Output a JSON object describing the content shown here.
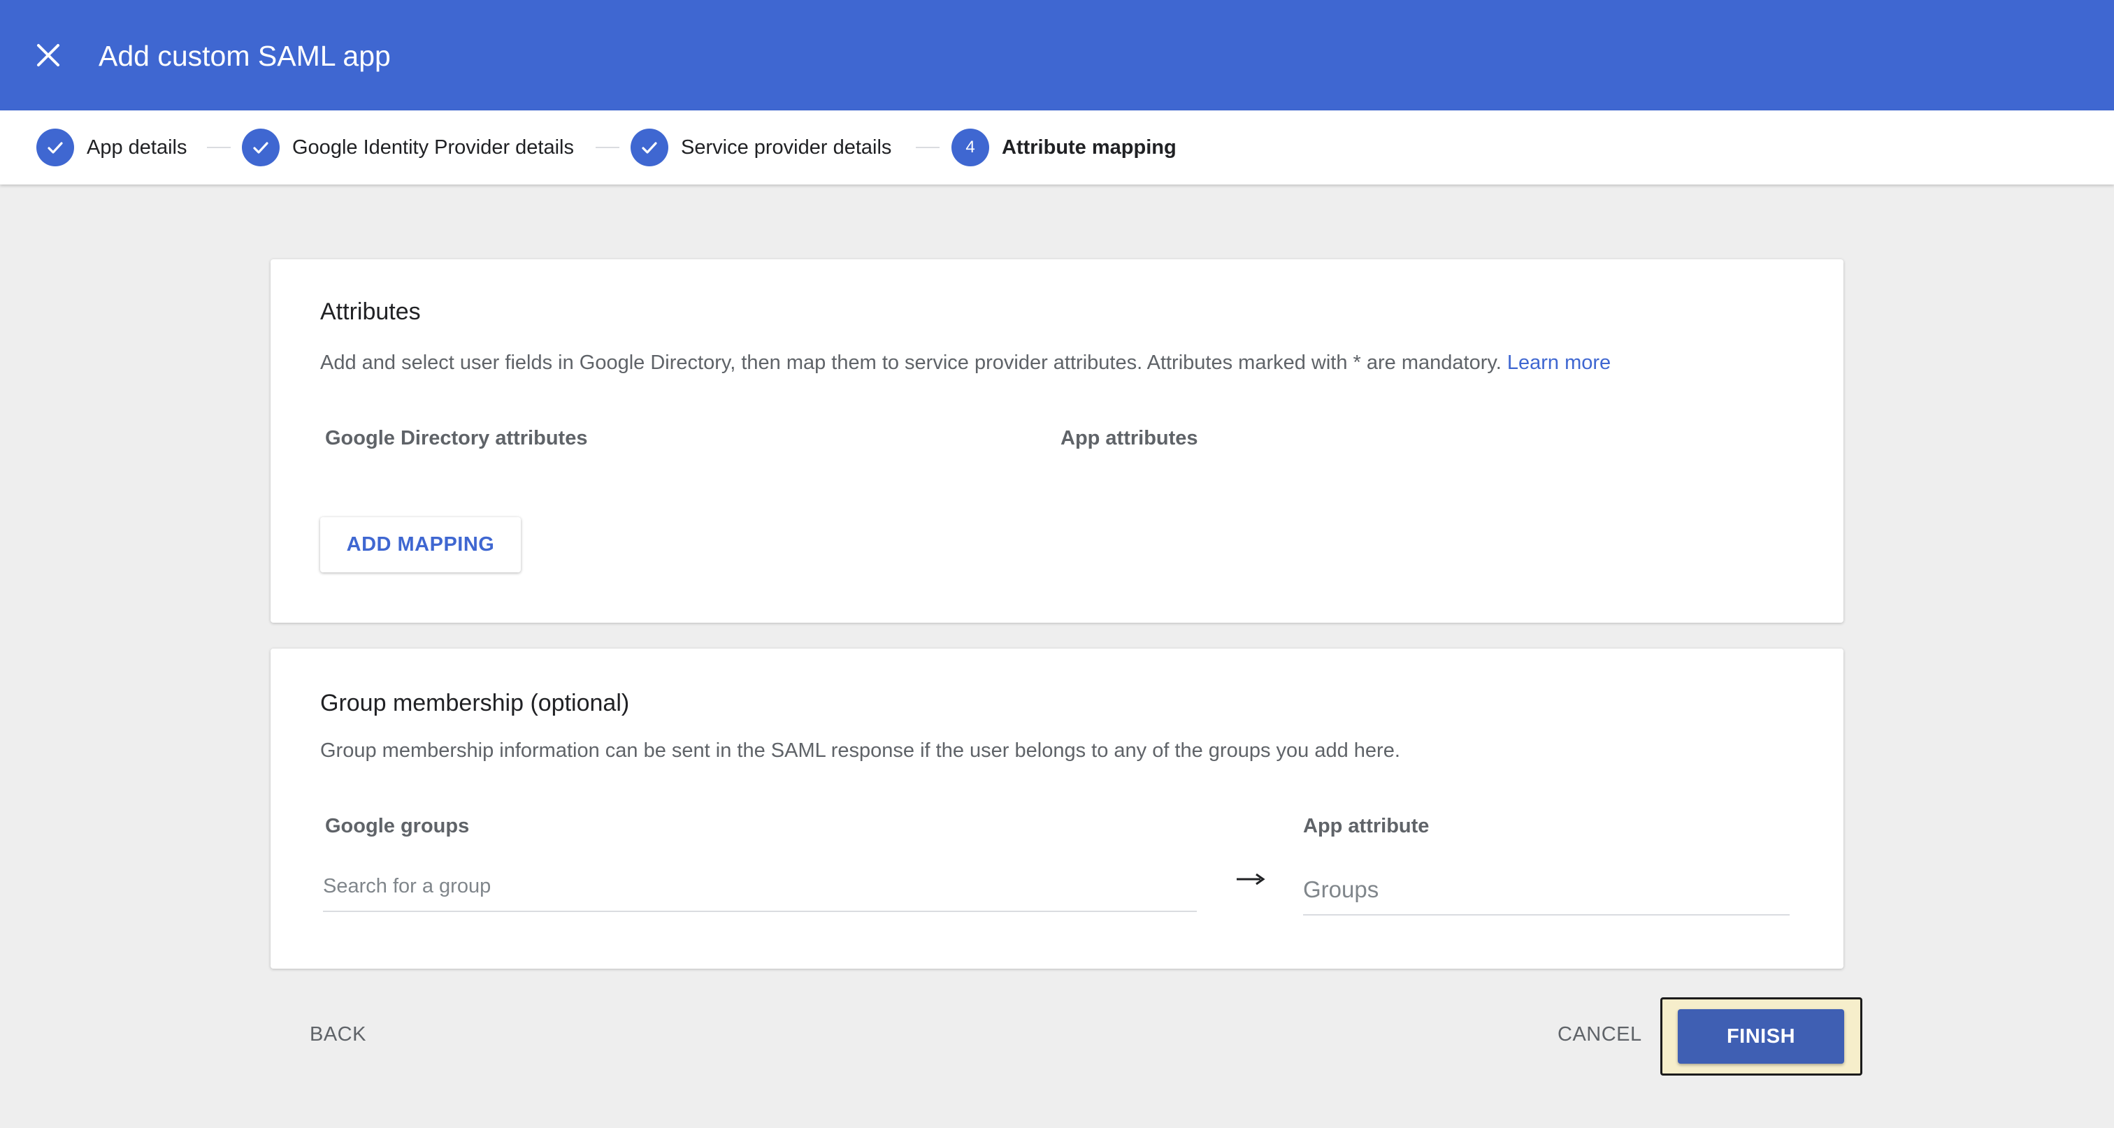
{
  "header": {
    "title": "Add custom SAML app",
    "close_icon": "close-icon",
    "background": "#3f67d1"
  },
  "stepper": {
    "steps": [
      {
        "label": "App details",
        "state": "complete",
        "icon": "check-icon"
      },
      {
        "label": "Google Identity Provider details",
        "state": "complete",
        "icon": "check-icon"
      },
      {
        "label": "Service provider details",
        "state": "complete",
        "icon": "check-icon"
      },
      {
        "label": "Attribute mapping",
        "state": "active",
        "number": "4"
      }
    ]
  },
  "attributes": {
    "title": "Attributes",
    "description": "Add and select user fields in Google Directory, then map them to service provider attributes. Attributes marked with * are mandatory.",
    "learn_more": "Learn more",
    "col_directory": "Google Directory attributes",
    "col_app": "App attributes",
    "add_mapping_label": "ADD MAPPING"
  },
  "groups": {
    "title": "Group membership (optional)",
    "description": "Group membership information can be sent in the SAML response if the user belongs to any of the groups you add here.",
    "col_google_groups": "Google groups",
    "col_app_attribute": "App attribute",
    "search_placeholder": "Search for a group",
    "app_attribute_placeholder": "Groups",
    "arrow_icon": "arrow-right-icon"
  },
  "footer": {
    "back_label": "BACK",
    "cancel_label": "CANCEL",
    "finish_label": "FINISH",
    "finish_color": "#3f5fb3"
  }
}
